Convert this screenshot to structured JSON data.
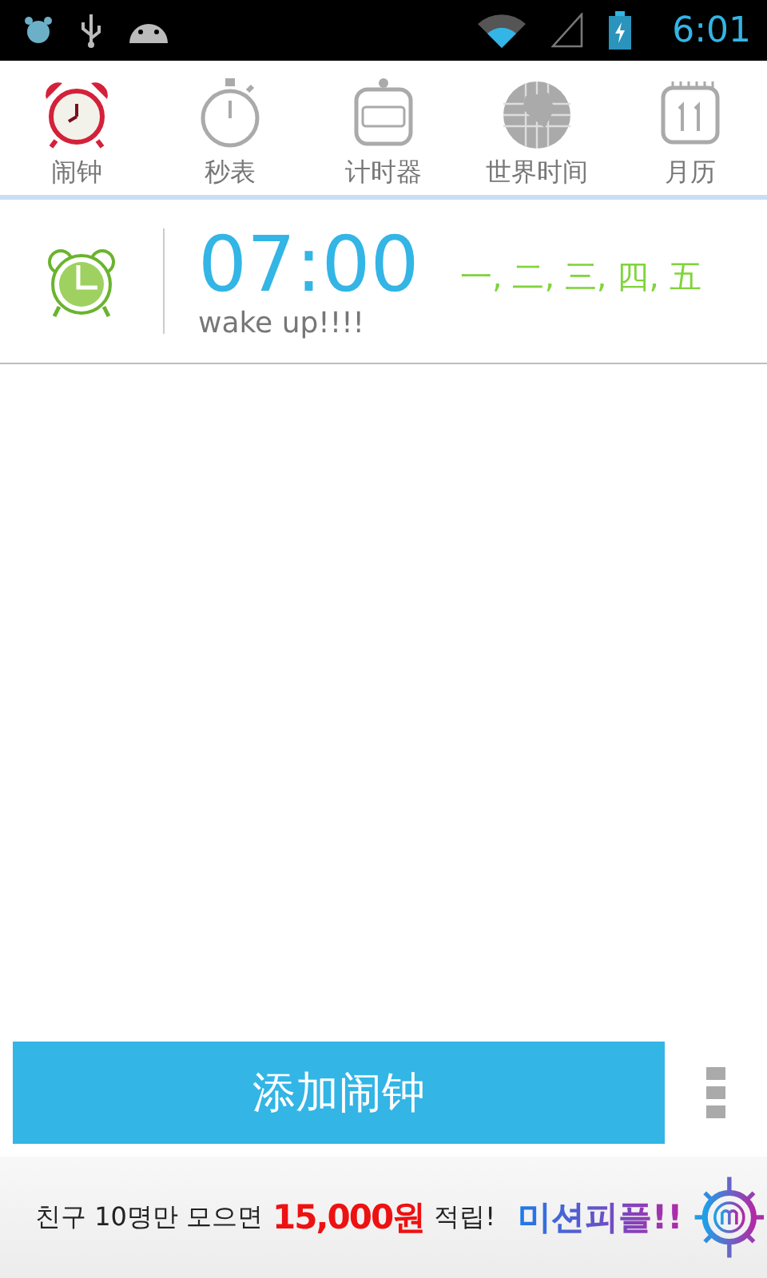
{
  "status_bar": {
    "time": "6:01"
  },
  "tabs": [
    {
      "label": "闹钟",
      "kind": "alarm",
      "selected": true
    },
    {
      "label": "秒表",
      "kind": "stopwatch",
      "selected": false
    },
    {
      "label": "计时器",
      "kind": "timer",
      "selected": false
    },
    {
      "label": "世界时间",
      "kind": "globe",
      "selected": false
    },
    {
      "label": "月历",
      "kind": "calendar",
      "selected": false
    }
  ],
  "alarms": [
    {
      "time": "07:00",
      "label": "wake up!!!!",
      "days": "一, 二, 三, 四, 五",
      "enabled": true
    }
  ],
  "add_button": "添加闹钟",
  "ad": {
    "text_before": "친구 10명만 모으면",
    "amount": "15,000원",
    "text_after": "적립!",
    "brand": "미션피플!!"
  }
}
